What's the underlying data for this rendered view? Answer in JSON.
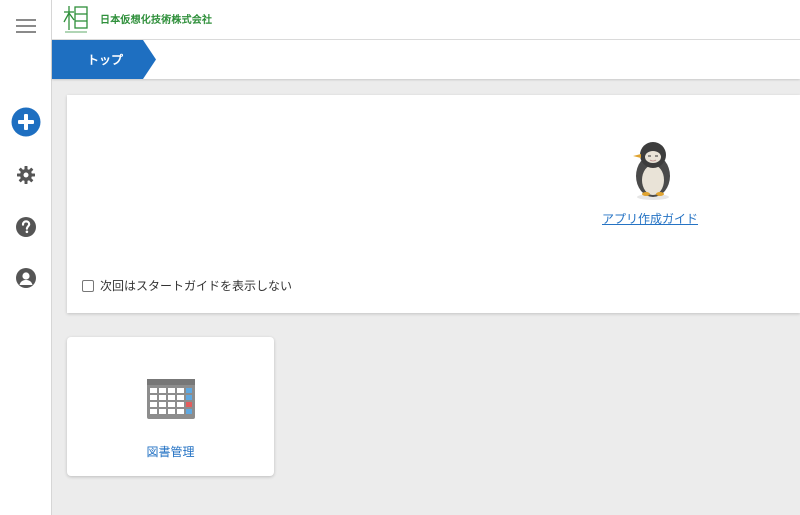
{
  "header": {
    "company_name": "日本仮想化技術株式会社",
    "logo_icon": "wood-eye-logo"
  },
  "rail": {
    "menu_icon": "hamburger-icon",
    "items": [
      {
        "icon": "plus-circle-icon"
      },
      {
        "icon": "gear-icon"
      },
      {
        "icon": "question-icon"
      },
      {
        "icon": "user-icon"
      }
    ]
  },
  "breadcrumb": {
    "items": [
      {
        "label": "トップ"
      }
    ]
  },
  "guide": {
    "link_label": "アプリ作成ガイド",
    "dont_show_label": "次回はスタートガイドを表示しない",
    "dont_show_checked": false,
    "mascot_icon": "penguin-mascot"
  },
  "apps": [
    {
      "label": "図書管理",
      "icon": "spreadsheet-icon"
    }
  ],
  "colors": {
    "accent": "#1e6fc1",
    "link": "#2573c4",
    "brand_green": "#2e8f3a",
    "rail_icon": "#555555"
  }
}
